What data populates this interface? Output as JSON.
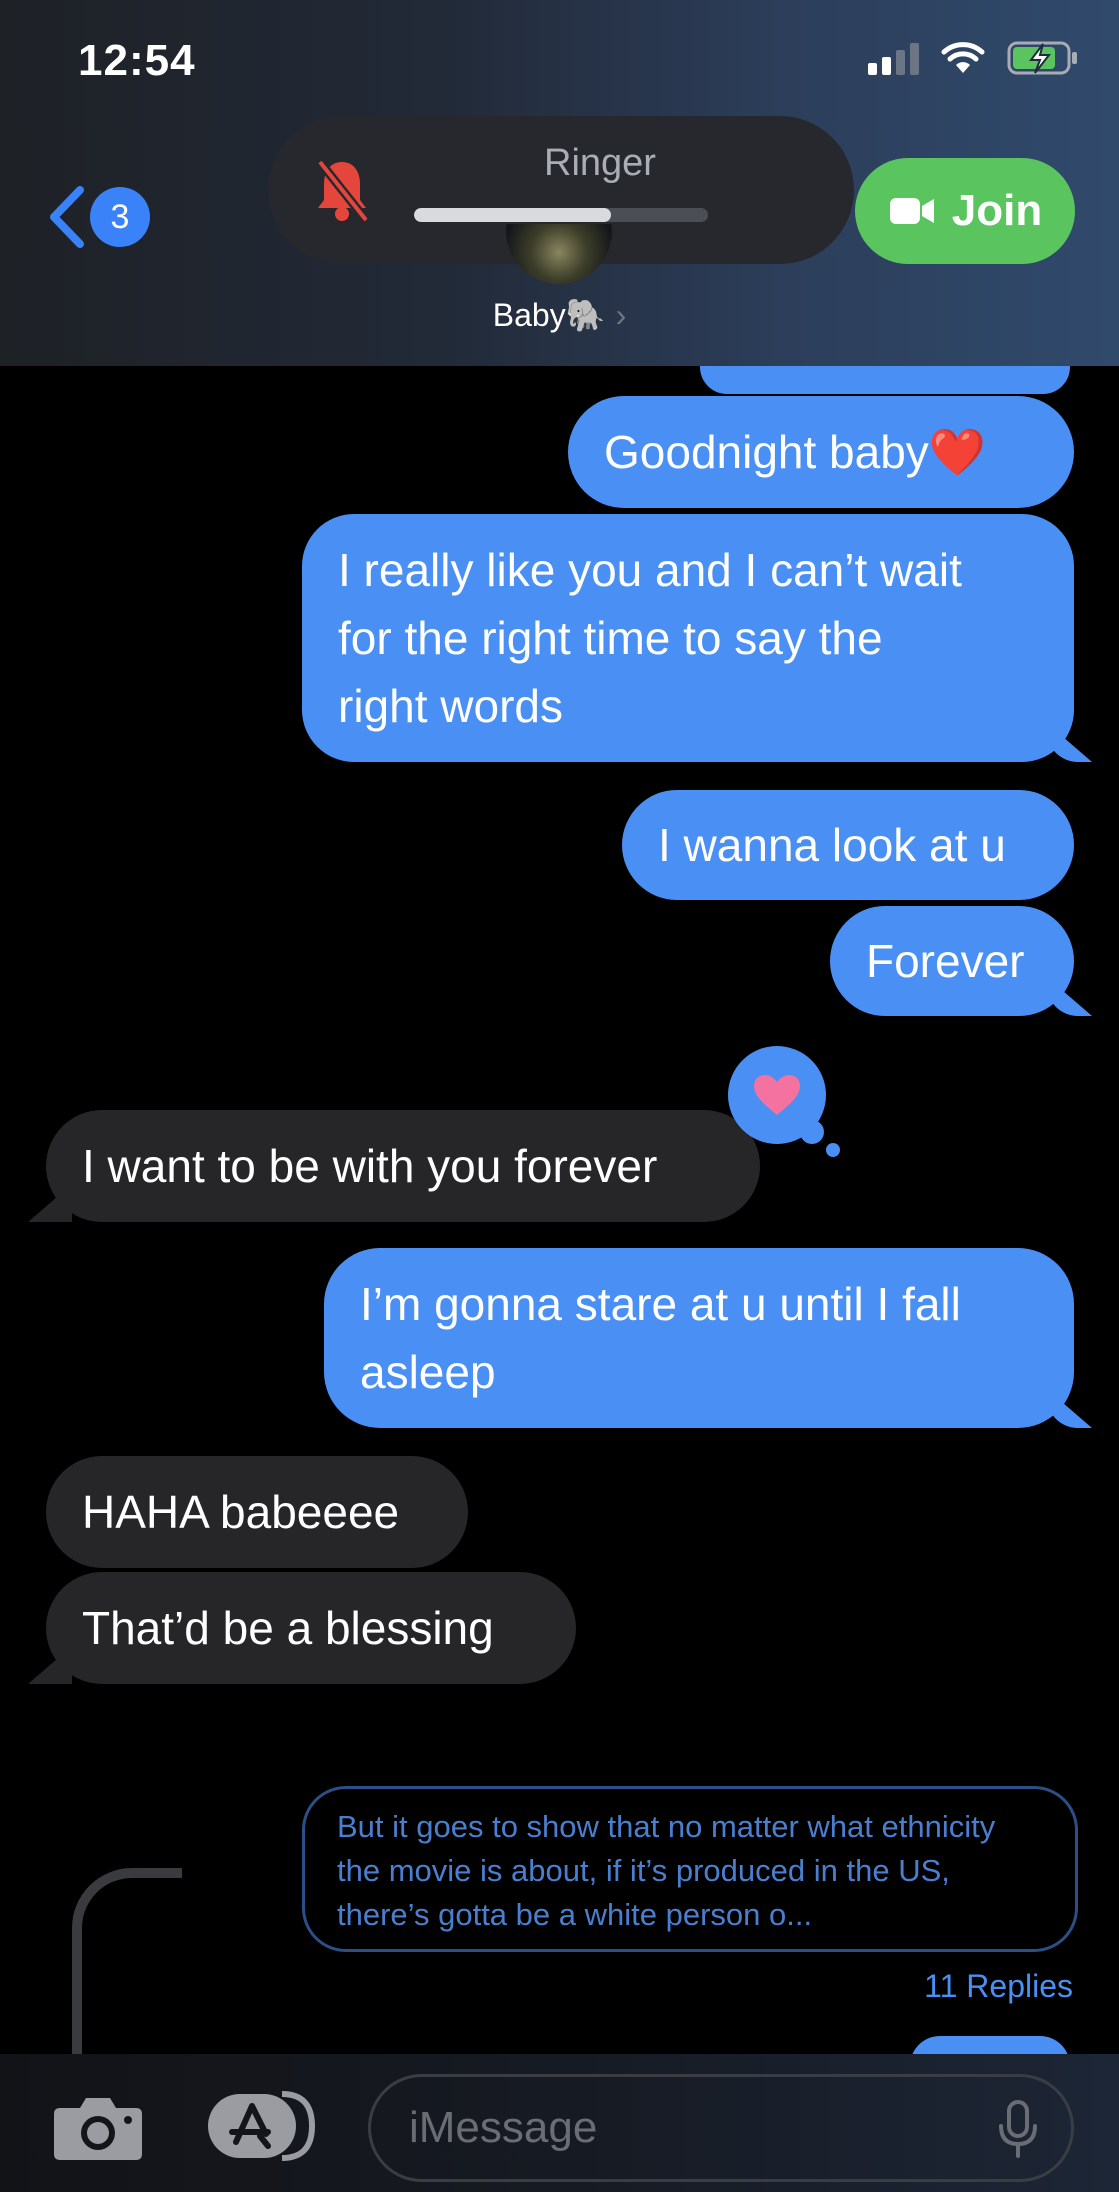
{
  "status_bar": {
    "time": "12:54"
  },
  "header": {
    "back_count": "3",
    "ringer_label": "Ringer",
    "ringer_level": 0.67,
    "join_label": "Join",
    "contact_name": "Baby🐘"
  },
  "messages": [
    {
      "from": "me",
      "text": "Goodnight baby❤️"
    },
    {
      "from": "me",
      "text": "I really like you and I can’t wait\nfor the right time to say the\nright words"
    },
    {
      "from": "me",
      "text": "I wanna look at u"
    },
    {
      "from": "me",
      "text": "Forever"
    },
    {
      "from": "them",
      "text": "I want to be with you forever",
      "tapback": "heart"
    },
    {
      "from": "me",
      "text": "I’m gonna stare at u until I fall\nasleep"
    },
    {
      "from": "them",
      "text": "HAHA babeeee"
    },
    {
      "from": "them",
      "text": "That’d be a blessing"
    }
  ],
  "reply_thread": {
    "preview_text": "But it goes to show that no matter what ethnicity the movie is about, if it’s produced in the US, there’s gotta be a white person o...",
    "replies_label": "11 Replies"
  },
  "input_bar": {
    "placeholder": "iMessage"
  },
  "colors": {
    "sent_bubble": "#4a8ff3",
    "received_bubble": "#262629",
    "join_green": "#5ac55e",
    "muted_bell_red": "#e5463b",
    "tapback_heart": "#f472a0"
  },
  "icons": {
    "back": "chevron-left-icon",
    "ringer": "bell-slash-icon",
    "join": "video-camera-icon",
    "camera": "camera-icon",
    "apps": "app-store-icon",
    "mic": "microphone-icon"
  }
}
